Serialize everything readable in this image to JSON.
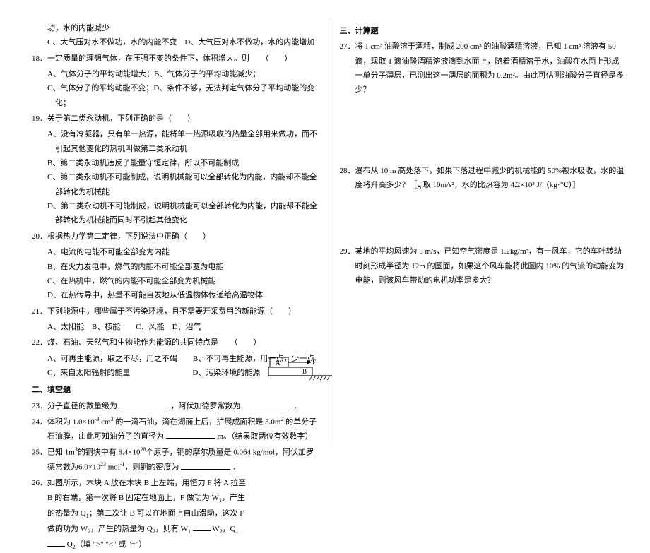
{
  "left": {
    "q17cont": "功，水的内能减少",
    "q17c": "C、大气压对水不做功，水的内能不变",
    "q17d": "D、大气压对水不做功，水的内能增加",
    "q18": "18．一定质量的理想气体，在压强不变的条件下，体积增大。则　　（　　）",
    "q18a": "A、气体分子的平均动能增大；B、气体分子的平均动能减少；",
    "q18c": "C、气体分子的平均动能不变；D、条件不够，无法判定气体分子平均动能的变化；",
    "q19": "19．关于第二类永动机，下列正确的是（　　）",
    "q19a": "A、没有冷凝器，只有单一热源，能将单一热源吸收的热量全部用来做功，而不引起其他变化的热机叫做第二类永动机",
    "q19b": "B、第二类永动机违反了能量守恒定律，所以不可能制成",
    "q19c": "C、第二类永动机不可能制成，说明机械能可以全部转化为内能，内能却不能全部转化为机械能",
    "q19d": "D、第二类永动机不可能制成，说明机械能可以全部转化为内能，内能却不能全部转化为机械能而同时不引起其他变化",
    "q20": "20．根据热力学第二定律，下列说法中正确（　　）",
    "q20a": "A、电流的电能不可能全部变为内能",
    "q20b": "B、在火力发电中，燃气的内能不可能全部变为电能",
    "q20c": "C、在热机中，燃气的内能不可能全部变为机械能",
    "q20d": "D、在热传导中，热量不可能自发地从低温物体传递给高温物体",
    "q21": "21．下列能源中，哪些属于不污染环境，且不需要开采费用的新能源（　　）",
    "q21opts": "A、太阳能　B、核能　　C、风能　D、沼气",
    "q22": "22．煤、石油、天然气和生物能作为能源的共同特点是　　（　　）",
    "q22a": "A、可再生能源，取之不尽，用之不竭　　B、不可再生能源，用一点，少一点",
    "q22c": "C、来自太阳辐射的能量　　　　　　　　D、污染环境的能源",
    "sec2": "二、填空题",
    "q23a": "23．分子直径的数量级为",
    "q23b": "，阿伏加德罗常数为",
    "q23c": "．",
    "q24a": "24．体积为 1.0×10",
    "q24b": " cm",
    "q24c": " 的一滴石油，滴在湖面上后，扩展成面积是 3.0m",
    "q24d": " 的单分子石油膜，由此可知油分子的直径为",
    "q24e": "m。（结果取两位有效数字）",
    "q25a": "25．已知 1m",
    "q25b": "的铜块中有 8.4×10",
    "q25c": "个原子，铜的摩尔质量是 0.064 kg/mol，阿伏加罗德常数为6.0×10",
    "q25d": " mol",
    "q25e": "，则铜的密度为",
    "q25f": "．",
    "q26": "26．如图所示，木块 A 放在木块 B 上左端，用恒力 F 将 A 拉至 B 的右端，第一次将 B 固定在地面上，F 做功为 W",
    "q26b": "，产生的热量为 Q",
    "q26c": "；第二次让 B 可以在地面上自由滑动，这次 F 做的功为 W",
    "q26d": "，产生的热量为 Q",
    "q26e": "，则有 W",
    "q26f": "W",
    "q26g": "，Q",
    "q26h": "Q",
    "q26i": "（填 \">\" \"<\" 或 \"=\"）"
  },
  "right": {
    "sec3": "三、计算题",
    "q27": "27．将 1 cm³ 油酸溶于酒精，制成 200 cm³ 的油酸酒精溶液，已知 1 cm³ 溶液有 50 滴，现取 1 滴油酸酒精溶液滴到水面上，随着酒精溶于水，油酸在水面上形成一单分子薄层，已测出这一薄层的面积为 0.2m²。由此可估测油酸分子直径是多少？",
    "q28": "28．瀑布从 10 m 高处落下，如果下落过程中减少的机械能的 50%被水吸收，水的温度将升高多少？［g 取 10m/s²，水的比热容为 4.2×10³ J/（kg·℃）］",
    "q29": "29．某地的平均风速为 5 m/s，已知空气密度是 1.2kg/m³，有一风车，它的车叶转动时刻形成半径为 12m 的圆面，如果这个风车能将此圆内 10% 的气流的动能变为电能，则该风车带动的电机功率是多大？"
  },
  "fig": {
    "labelA": "A",
    "labelF": "F",
    "labelB": "B"
  }
}
